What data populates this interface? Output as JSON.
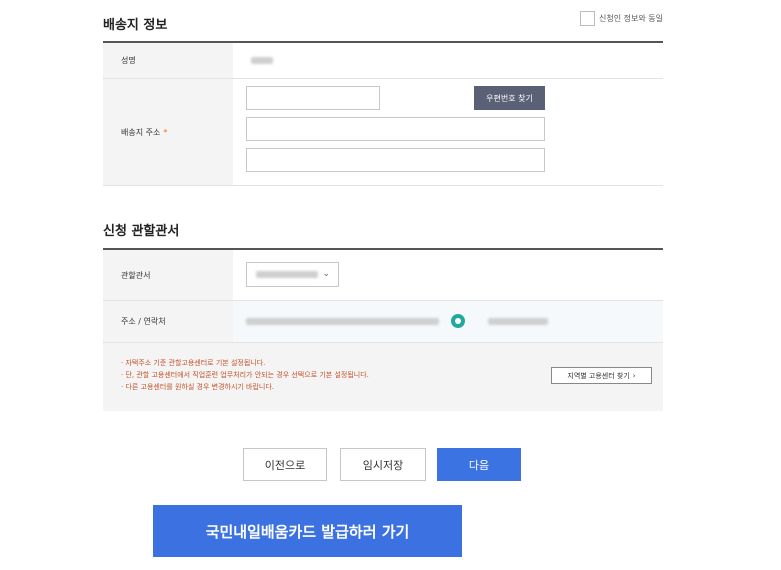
{
  "delivery": {
    "title": "배송지 정보",
    "same_as_applicant_label": "신청인 정보와 동일",
    "name_label": "성명",
    "address_label": "배송지 주소",
    "required_mark": "*",
    "zip_button": "우편번호 찾기"
  },
  "office": {
    "title": "신청 관할관서",
    "office_label": "관할관서",
    "address_contact_label": "주소 / 연락처",
    "notices": [
      "· 자택주소 기준 관할고용센터로 기본 설정됩니다.",
      "· 단, 관할 고용센터에서 직업훈련 업무처리가 안되는 경우 선택으로 기본 설정됩니다.",
      "· 다른 고용센터를 원하실 경우 변경하시기 바랍니다."
    ],
    "region_button": "지역별 고용센터 찾기",
    "region_button_chevron": "›"
  },
  "actions": {
    "prev": "이전으로",
    "save": "임시저장",
    "next": "다음"
  },
  "card_button": "국민내일배움카드 발급하러 가기",
  "colors": {
    "primary": "#3c73e3",
    "zip_button": "#5a6177",
    "location_pin": "#1fa9a0",
    "notice_text": "#c4522b",
    "required_mark": "#e8711b"
  }
}
